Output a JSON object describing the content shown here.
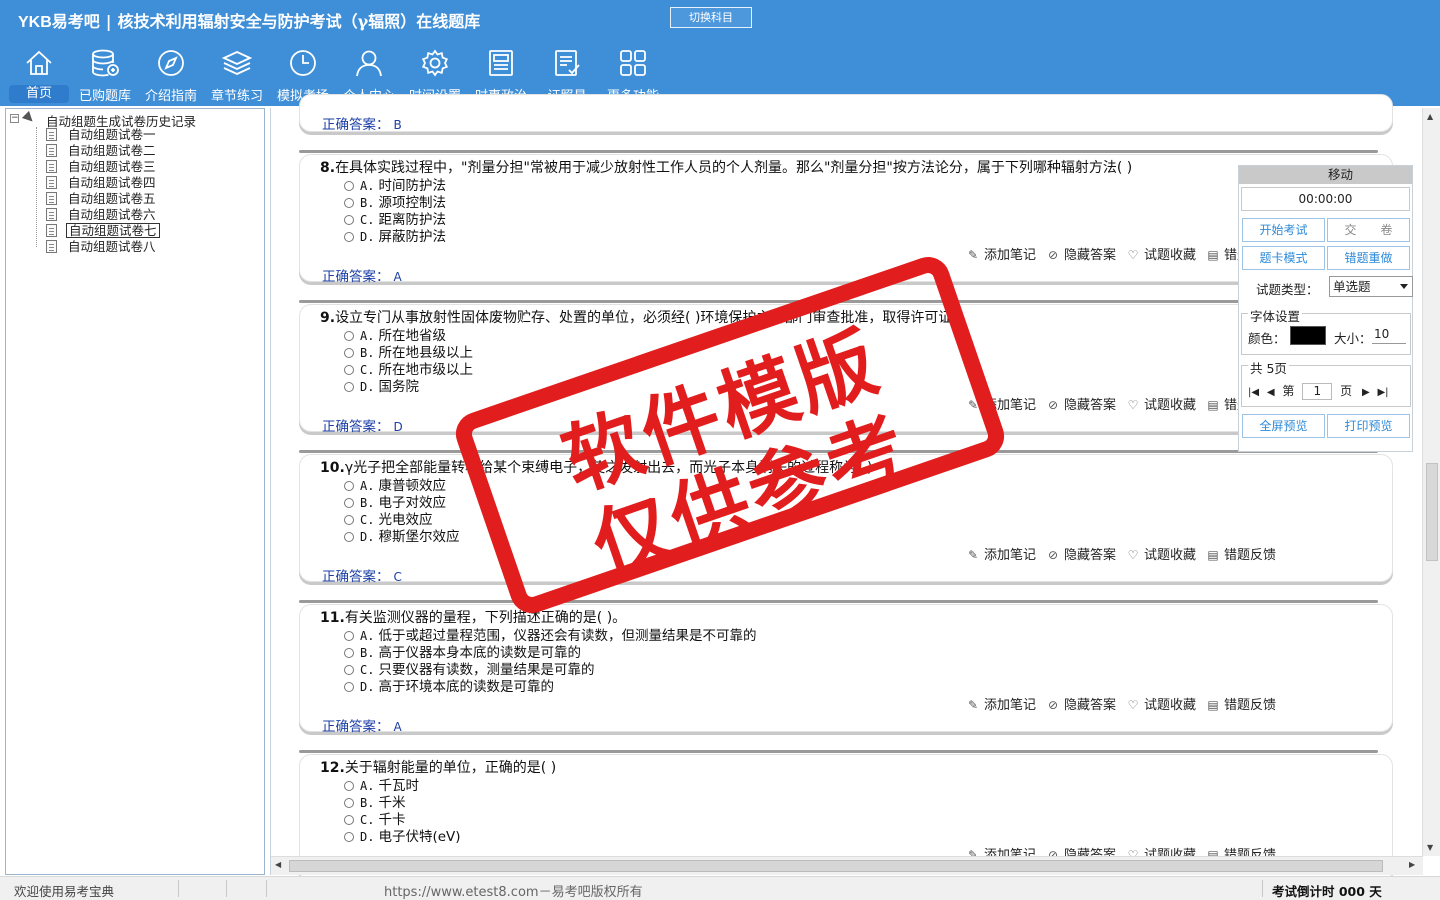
{
  "header": {
    "brand": "YKB易考吧",
    "title": "核技术利用辐射安全与防护考试（γ辐照）在线题库",
    "switch_label": "切换科目"
  },
  "toolbar": [
    {
      "label": "首页",
      "icon": "home-icon",
      "active": true
    },
    {
      "label": "已购题库",
      "icon": "database-icon"
    },
    {
      "label": "介绍指南",
      "icon": "compass-icon"
    },
    {
      "label": "章节练习",
      "icon": "layers-icon"
    },
    {
      "label": "模拟考场",
      "icon": "clock-icon"
    },
    {
      "label": "个人中心",
      "icon": "user-icon"
    },
    {
      "label": "时间设置",
      "icon": "gear-icon"
    },
    {
      "label": "时事政治",
      "icon": "newspaper-icon"
    },
    {
      "label": "证照易",
      "icon": "certificate-icon"
    },
    {
      "label": "更多功能",
      "icon": "grid-icon"
    }
  ],
  "tree": {
    "root_label": "自动组题生成试卷历史记录",
    "toggle": "−",
    "items": [
      "自动组题试卷一",
      "自动组题试卷二",
      "自动组题试卷三",
      "自动组题试卷四",
      "自动组题试卷五",
      "自动组题试卷六",
      "自动组题试卷七",
      "自动组题试卷八"
    ],
    "selected_index": 6
  },
  "answer_label": "正确答案：",
  "actions": [
    {
      "label": "添加笔记",
      "icon": "pencil-icon"
    },
    {
      "label": "隐藏答案",
      "icon": "eye-off-icon"
    },
    {
      "label": "试题收藏",
      "icon": "heart-icon"
    },
    {
      "label": "错题反馈",
      "icon": "feedback-icon"
    }
  ],
  "prev_answer": "B",
  "questions": [
    {
      "num": "8.",
      "text": "在具体实践过程中，\"剂量分担\"常被用于减少放射性工作人员的个人剂量。那么\"剂量分担\"按方法论分，属于下列哪种辐射方法( )",
      "options": [
        {
          "key": "A.",
          "text": "时间防护法"
        },
        {
          "key": "B.",
          "text": "源项控制法"
        },
        {
          "key": "C.",
          "text": "距离防护法"
        },
        {
          "key": "D.",
          "text": "屏蔽防护法"
        }
      ],
      "answer": "A"
    },
    {
      "num": "9.",
      "text": "设立专门从事放射性固体废物贮存、处置的单位，必须经(   )环境保护主管部门审查批准，取得许可证。",
      "options": [
        {
          "key": "A.",
          "text": "所在地省级"
        },
        {
          "key": "B.",
          "text": "所在地县级以上"
        },
        {
          "key": "C.",
          "text": "所在地市级以上"
        },
        {
          "key": "D.",
          "text": "国务院"
        }
      ],
      "answer": "D"
    },
    {
      "num": "10.",
      "text": "γ光子把全部能量转移给某个束缚电子，使之发射出去，而光子本身消失的过程称为(   )",
      "options": [
        {
          "key": "A.",
          "text": "康普顿效应"
        },
        {
          "key": "B.",
          "text": "电子对效应"
        },
        {
          "key": "C.",
          "text": "光电效应"
        },
        {
          "key": "D.",
          "text": "穆斯堡尔效应"
        }
      ],
      "answer": "C"
    },
    {
      "num": "11.",
      "text": "有关监测仪器的量程，下列描述正确的是(   )。",
      "options": [
        {
          "key": "A.",
          "text": "低于或超过量程范围，仪器还会有读数，但测量结果是不可靠的"
        },
        {
          "key": "B.",
          "text": "高于仪器本身本底的读数是可靠的"
        },
        {
          "key": "C.",
          "text": "只要仪器有读数，测量结果是可靠的"
        },
        {
          "key": "D.",
          "text": "高于环境本底的读数是可靠的"
        }
      ],
      "answer": "A"
    },
    {
      "num": "12.",
      "text": "关于辐射能量的单位，正确的是( )",
      "options": [
        {
          "key": "A.",
          "text": "千瓦时"
        },
        {
          "key": "B.",
          "text": "千米"
        },
        {
          "key": "C.",
          "text": "千卡"
        },
        {
          "key": "D.",
          "text": "电子伏特(eV)"
        }
      ],
      "answer": ""
    }
  ],
  "control": {
    "title": "移动",
    "timer": "00:00:00",
    "start_exam": "开始考试",
    "submit": "交　　卷",
    "card_mode": "题卡模式",
    "wrong_redo": "错题重做",
    "type_label": "试题类型：",
    "type_value": "单选题",
    "font_group": "字体设置",
    "color_label": "颜色：",
    "size_label": "大小：",
    "size_value": "10",
    "page_group": "共 5页",
    "page_prefix": "第",
    "page_value": "1",
    "page_suffix": "页",
    "fullscreen": "全屏预览",
    "print": "打印预览"
  },
  "status": {
    "left": "欢迎使用易考宝典",
    "center": "https://www.etest8.com－易考吧版权所有",
    "right": "考试倒计时 000 天"
  },
  "stamp": {
    "line1": "软件模版",
    "line2": "仅供参考"
  }
}
